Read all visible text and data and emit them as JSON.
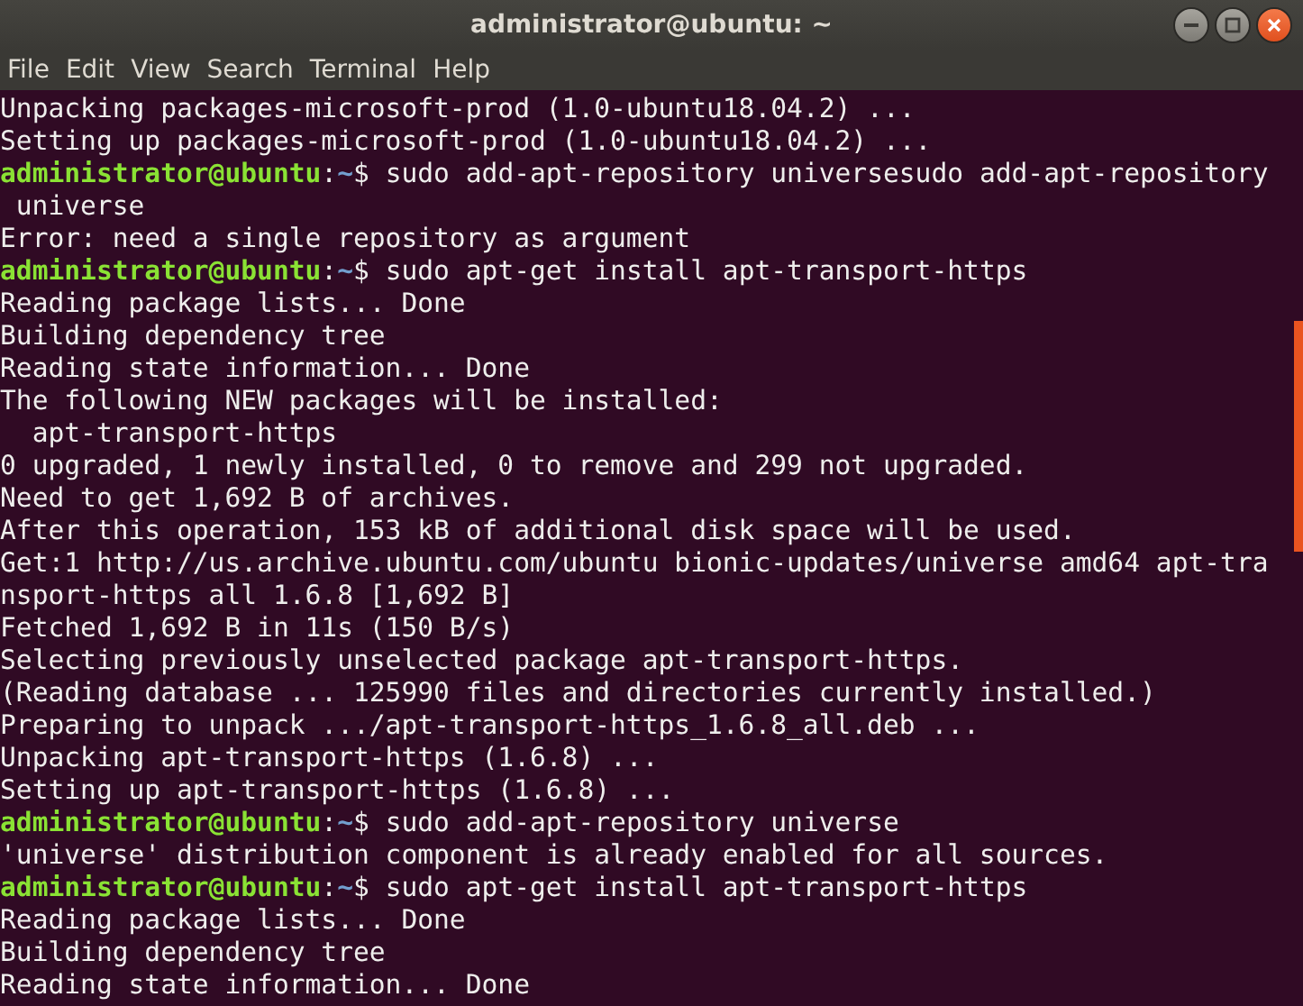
{
  "window": {
    "title": "administrator@ubuntu: ~"
  },
  "menu": [
    "File",
    "Edit",
    "View",
    "Search",
    "Terminal",
    "Help"
  ],
  "lines": [
    {
      "kind": "output",
      "text": "Unpacking packages-microsoft-prod (1.0-ubuntu18.04.2) ..."
    },
    {
      "kind": "output",
      "text": "Setting up packages-microsoft-prod (1.0-ubuntu18.04.2) ..."
    },
    {
      "kind": "prompt",
      "user": "administrator@ubuntu",
      "separator": ":",
      "path": "~",
      "symbol": "$",
      "command": "sudo add-apt-repository universesudo add-apt-repository"
    },
    {
      "kind": "continuation",
      "text": "universe"
    },
    {
      "kind": "output",
      "text": "Error: need a single repository as argument"
    },
    {
      "kind": "prompt",
      "user": "administrator@ubuntu",
      "separator": ":",
      "path": "~",
      "symbol": "$",
      "command": "sudo apt-get install apt-transport-https"
    },
    {
      "kind": "output",
      "text": "Reading package lists... Done"
    },
    {
      "kind": "output",
      "text": "Building dependency tree"
    },
    {
      "kind": "output",
      "text": "Reading state information... Done"
    },
    {
      "kind": "output",
      "text": "The following NEW packages will be installed:"
    },
    {
      "kind": "output",
      "text": "  apt-transport-https"
    },
    {
      "kind": "output",
      "text": "0 upgraded, 1 newly installed, 0 to remove and 299 not upgraded."
    },
    {
      "kind": "output",
      "text": "Need to get 1,692 B of archives."
    },
    {
      "kind": "output",
      "text": "After this operation, 153 kB of additional disk space will be used."
    },
    {
      "kind": "output",
      "text": "Get:1 http://us.archive.ubuntu.com/ubuntu bionic-updates/universe amd64 apt-tra"
    },
    {
      "kind": "output",
      "text": "nsport-https all 1.6.8 [1,692 B]"
    },
    {
      "kind": "output",
      "text": "Fetched 1,692 B in 11s (150 B/s)"
    },
    {
      "kind": "output",
      "text": "Selecting previously unselected package apt-transport-https."
    },
    {
      "kind": "output",
      "text": "(Reading database ... 125990 files and directories currently installed.)"
    },
    {
      "kind": "output",
      "text": "Preparing to unpack .../apt-transport-https_1.6.8_all.deb ..."
    },
    {
      "kind": "output",
      "text": "Unpacking apt-transport-https (1.6.8) ..."
    },
    {
      "kind": "output",
      "text": "Setting up apt-transport-https (1.6.8) ..."
    },
    {
      "kind": "prompt",
      "user": "administrator@ubuntu",
      "separator": ":",
      "path": "~",
      "symbol": "$",
      "command": "sudo add-apt-repository universe"
    },
    {
      "kind": "output",
      "text": "'universe' distribution component is already enabled for all sources."
    },
    {
      "kind": "prompt",
      "user": "administrator@ubuntu",
      "separator": ":",
      "path": "~",
      "symbol": "$",
      "command": "sudo apt-get install apt-transport-https"
    },
    {
      "kind": "output",
      "text": "Reading package lists... Done"
    },
    {
      "kind": "output",
      "text": "Building dependency tree"
    },
    {
      "kind": "output",
      "text": "Reading state information... Done"
    }
  ]
}
